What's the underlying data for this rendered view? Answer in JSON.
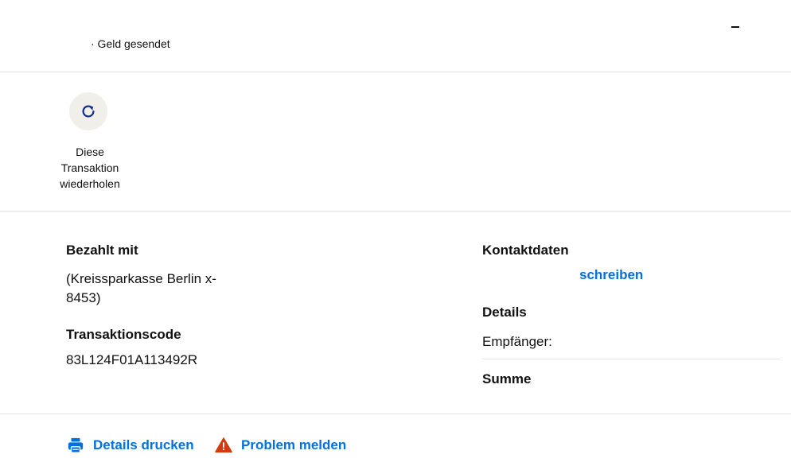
{
  "header": {
    "status_text": "· Geld gesendet"
  },
  "repeat": {
    "label": "Diese Transaktion wiederholen",
    "icon": "refresh-icon"
  },
  "payment": {
    "paid_with_label": "Bezahlt mit",
    "paid_with_value": "(Kreissparkasse Berlin x-8453)",
    "transaction_code_label": "Transaktionscode",
    "transaction_code_value": "83L124F01A113492R"
  },
  "contact": {
    "label": "Kontaktdaten",
    "write_link": "schreiben"
  },
  "details": {
    "label": "Details",
    "recipient_label": "Empfänger:",
    "sum_label": "Summe"
  },
  "actions": {
    "print_label": "Details drucken",
    "report_label": "Problem melden"
  },
  "colors": {
    "link": "#0070e0",
    "warning": "#d03c0f",
    "repeat_bg": "#f1efea",
    "icon_dark": "#142c8e"
  }
}
